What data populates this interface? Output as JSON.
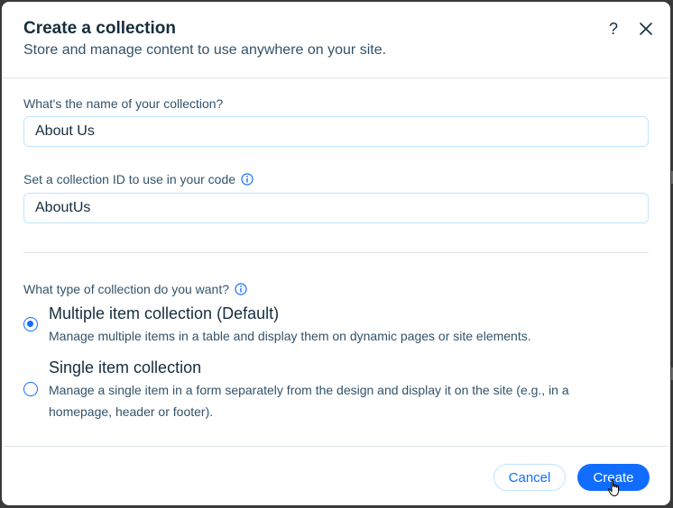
{
  "dialog": {
    "title": "Create a collection",
    "subtitle": "Store and manage content to use anywhere on your site.",
    "help_label": "?"
  },
  "name_field": {
    "label": "What's the name of your collection?",
    "value": "About Us"
  },
  "id_field": {
    "label": "Set a collection ID to use in your code",
    "value": "AboutUs"
  },
  "collection_type": {
    "label": "What type of collection do you want?",
    "options": [
      {
        "title": "Multiple item collection (Default)",
        "description": "Manage multiple items in a table and display them on dynamic pages or site elements.",
        "selected": true
      },
      {
        "title": "Single item collection",
        "description": "Manage a single item in a form separately from the design and display it on the site (e.g., in a homepage, header or footer).",
        "selected": false
      }
    ]
  },
  "footer": {
    "cancel_label": "Cancel",
    "create_label": "Create"
  },
  "colors": {
    "accent": "#116dff",
    "text": "#162d3d",
    "secondary_text": "#32536a",
    "border": "#c1e4fe"
  },
  "icons": {
    "help": "question-mark-icon",
    "close": "close-icon",
    "info": "info-icon",
    "cursor": "hand-pointer-icon"
  }
}
